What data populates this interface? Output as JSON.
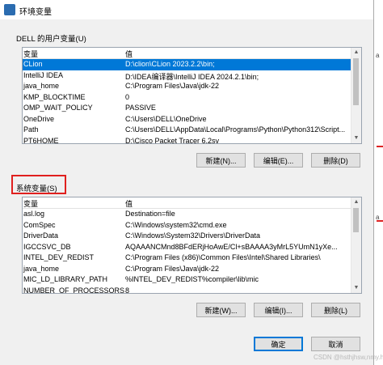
{
  "window": {
    "title": "环境变量"
  },
  "user_vars": {
    "label": "DELL 的用户变量(U)",
    "col_name": "变量",
    "col_value": "值",
    "rows": [
      {
        "name": "CLion",
        "value": "D:\\clion\\CLion 2023.2.2\\bin;",
        "selected": true
      },
      {
        "name": "IntelliJ IDEA",
        "value": "D:\\IDEA编译器\\IntelliJ IDEA 2024.2.1\\bin;"
      },
      {
        "name": "java_home",
        "value": "C:\\Program Files\\Java\\jdk-22"
      },
      {
        "name": "KMP_BLOCKTIME",
        "value": "0"
      },
      {
        "name": "OMP_WAIT_POLICY",
        "value": "PASSIVE"
      },
      {
        "name": "OneDrive",
        "value": "C:\\Users\\DELL\\OneDrive"
      },
      {
        "name": "Path",
        "value": "C:\\Users\\DELL\\AppData\\Local\\Programs\\Python\\Python312\\Script..."
      },
      {
        "name": "PT6HOME",
        "value": "D:\\Cisco Packet Tracer 6.2sv"
      }
    ],
    "buttons": {
      "new": "新建(N)...",
      "edit": "编辑(E)...",
      "delete": "删除(D)"
    }
  },
  "system_vars": {
    "label": "系统变量(S)",
    "col_name": "变量",
    "col_value": "值",
    "rows": [
      {
        "name": "asl.log",
        "value": "Destination=file"
      },
      {
        "name": "ComSpec",
        "value": "C:\\Windows\\system32\\cmd.exe"
      },
      {
        "name": "DriverData",
        "value": "C:\\Windows\\System32\\Drivers\\DriverData"
      },
      {
        "name": "IGCCSVC_DB",
        "value": "AQAAANCMnd8BFdERjHoAwE/Cl+sBAAAA3yMrL5YUmN1yXe..."
      },
      {
        "name": "INTEL_DEV_REDIST",
        "value": "C:\\Program Files (x86)\\Common Files\\Intel\\Shared Libraries\\"
      },
      {
        "name": "java_home",
        "value": "C:\\Program Files\\Java\\jdk-22"
      },
      {
        "name": "MIC_LD_LIBRARY_PATH",
        "value": "%INTEL_DEV_REDIST%compiler\\lib\\mic"
      },
      {
        "name": "NUMBER_OF_PROCESSORS",
        "value": "8"
      }
    ],
    "buttons": {
      "new": "新建(W)...",
      "edit": "编辑(I)...",
      "delete": "删除(L)"
    }
  },
  "footer": {
    "ok": "确定",
    "cancel": "取消"
  },
  "watermark": "CSDN @hsthjhsw,nmy.hsm",
  "highlight_color": "#e0201e",
  "selection_color": "#0078d7"
}
